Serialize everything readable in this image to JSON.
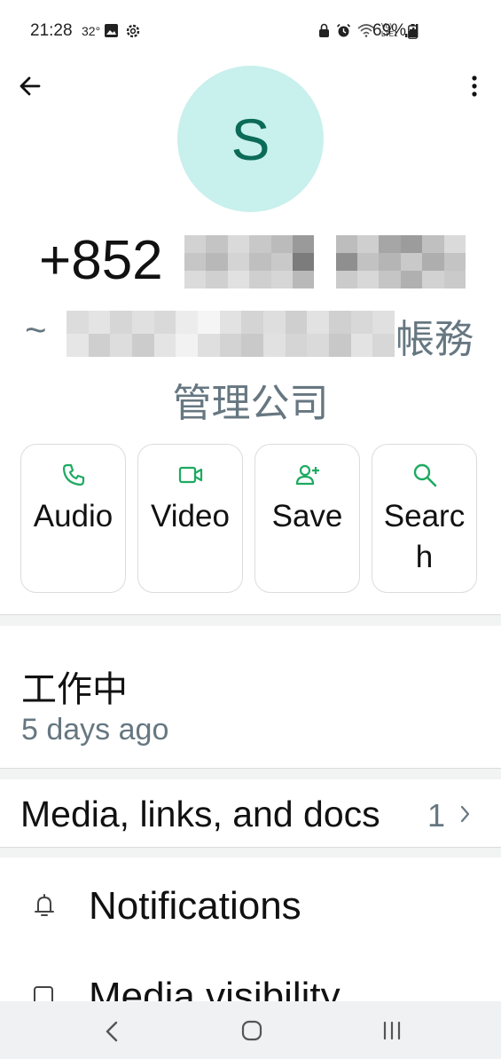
{
  "status_bar": {
    "time": "21:28",
    "temperature": "32°",
    "battery": "69%",
    "icons_left": [
      "image-icon",
      "gear-icon"
    ],
    "icons_right": [
      "lock-icon",
      "alarm-icon",
      "wifi-icon",
      "volte-icon",
      "signal-icon",
      "battery-icon"
    ],
    "volte_text": "Vo) LTE1"
  },
  "header": {
    "avatar_letter": "S",
    "phone_prefix": "+852",
    "pushname_prefix": "~",
    "pushname_suffix_line1": "帳務",
    "pushname_suffix_line2": "管理公司",
    "colors": {
      "avatar_bg": "#c8f0ec",
      "avatar_fg": "#0b6b58",
      "accent": "#1daa61"
    }
  },
  "actions": [
    {
      "label": "Audio",
      "icon": "phone-icon"
    },
    {
      "label": "Video",
      "icon": "video-icon"
    },
    {
      "label": "Save",
      "icon": "add-person-icon"
    },
    {
      "label": "Search",
      "icon": "search-icon"
    }
  ],
  "about": {
    "text": "工作中",
    "time": "5 days ago"
  },
  "media": {
    "label": "Media, links, and docs",
    "count": "1"
  },
  "settings": [
    {
      "label": "Notifications",
      "icon": "bell-icon"
    },
    {
      "label": "Media visibility",
      "icon": "media-visibility-icon"
    }
  ],
  "nav_bar": {
    "buttons": [
      "back-icon",
      "home-icon",
      "recents-icon"
    ]
  }
}
